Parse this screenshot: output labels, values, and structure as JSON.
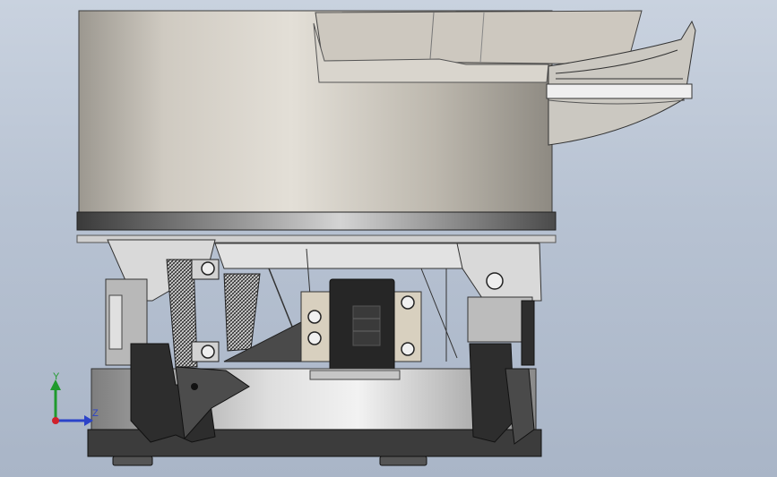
{
  "viewport": {
    "background_top": "#c9d2df",
    "background_bottom": "#a9b5c7"
  },
  "triad": {
    "y_label": "Y",
    "z_label": "Z",
    "y_color": "#1f9a2d",
    "z_color": "#2b43c9",
    "x_color": "#d0212b"
  },
  "model": {
    "bowl_color": "#c7c3bb",
    "steel_dark": "#2e2e2e",
    "steel_mid": "#8e8e8e",
    "aluminum": "#d8d8d8"
  }
}
